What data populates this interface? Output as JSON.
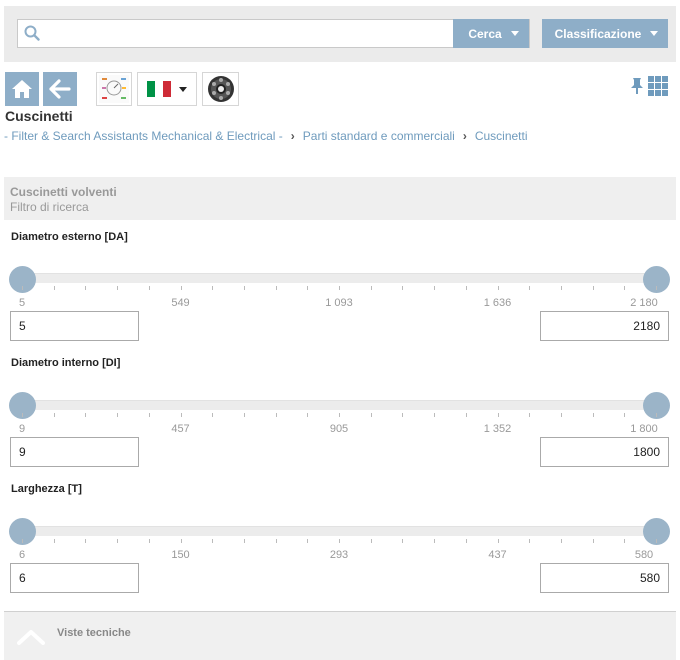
{
  "search": {
    "placeholder": "",
    "value": ""
  },
  "toolbar": {
    "search_label": "Cerca",
    "classification_label": "Classificazione"
  },
  "page": {
    "title": "Cuscinetti"
  },
  "breadcrumb": [
    "- Filter & Search Assistants Mechanical & Electrical -",
    "Parti standard e commerciali",
    "Cuscinetti"
  ],
  "filter": {
    "header": "Cuscinetti volventi",
    "subheader": "Filtro di ricerca"
  },
  "sliders": [
    {
      "label": "Diametro esterno [DA]",
      "min": "5",
      "max": "2180",
      "min_value": 0,
      "max_value": 1,
      "ticks": [
        "5",
        "549",
        "1 093",
        "1 636",
        "2 180"
      ]
    },
    {
      "label": "Diametro interno [DI]",
      "min": "9",
      "max": "1800",
      "min_value": 0,
      "max_value": 1,
      "ticks": [
        "9",
        "457",
        "905",
        "1 352",
        "1 800"
      ]
    },
    {
      "label": "Larghezza [T]",
      "min": "6",
      "max": "580",
      "min_value": 0,
      "max_value": 1,
      "ticks": [
        "6",
        "150",
        "293",
        "437",
        "580"
      ]
    }
  ],
  "footer": {
    "label": "Viste tecniche"
  },
  "colors": {
    "accent": "#8eaec8",
    "link": "#6f9bbd",
    "handle": "#9bb4c8",
    "flag_green": "#009246",
    "flag_red": "#ce2b37"
  },
  "icons": [
    "search-icon",
    "home-icon",
    "arrow-left-icon",
    "caret-down-icon",
    "pin-icon",
    "grid-view-icon",
    "chevron-up-icon"
  ]
}
